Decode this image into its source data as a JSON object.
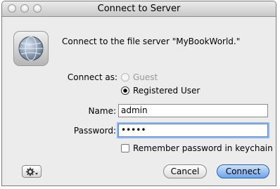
{
  "window": {
    "title": "Connect to Server"
  },
  "message": "Connect to the file server \"MyBookWorld.\"",
  "connect_as": {
    "label": "Connect as:",
    "options": [
      "Guest",
      "Registered User"
    ],
    "selected": "Registered User"
  },
  "fields": {
    "name_label": "Name:",
    "name_value": "admin",
    "password_label": "Password:",
    "password_value": "•••••"
  },
  "remember": {
    "label": "Remember password in keychain",
    "checked": false
  },
  "buttons": {
    "cancel": "Cancel",
    "connect": "Connect"
  },
  "icons": {
    "server": "globe-icon",
    "action": "gear-icon"
  },
  "colors": {
    "default_button": "#6ea3e8",
    "focus_ring": "#8fb7ea"
  }
}
